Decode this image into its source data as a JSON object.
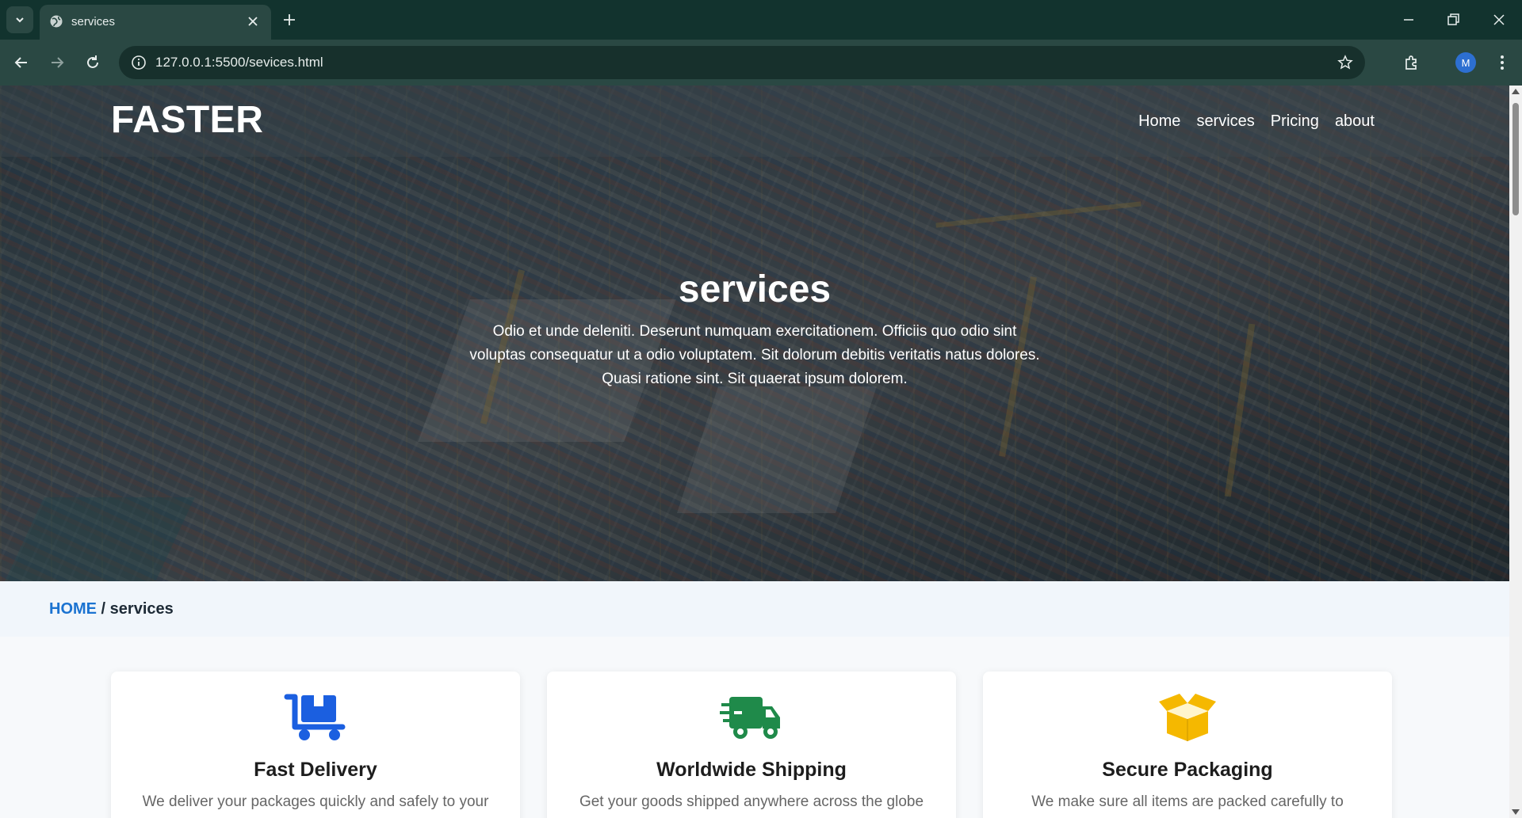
{
  "browser": {
    "tab_title": "services",
    "url": "127.0.0.1:5500/sevices.html",
    "profile_initial": "M"
  },
  "site": {
    "logo": "FASTER",
    "nav": [
      {
        "label": "Home"
      },
      {
        "label": "services"
      },
      {
        "label": "Pricing"
      },
      {
        "label": "about"
      }
    ]
  },
  "hero": {
    "title": "services",
    "text": "Odio et unde deleniti. Deserunt numquam exercitationem. Officiis quo odio sint voluptas consequatur ut a odio voluptatem. Sit dolorum debitis veritatis natus dolores. Quasi ratione sint. Sit quaerat ipsum dolorem."
  },
  "breadcrumb": {
    "home": "HOME",
    "separator": " / ",
    "current": "services"
  },
  "services": [
    {
      "title": "Fast Delivery",
      "text": "We deliver your packages quickly and safely to your",
      "icon": "dolly-icon",
      "color": "#1b5fe0"
    },
    {
      "title": "Worldwide Shipping",
      "text": "Get your goods shipped anywhere across the globe",
      "icon": "truck-fast-icon",
      "color": "#1f8a4a"
    },
    {
      "title": "Secure Packaging",
      "text": "We make sure all items are packed carefully to",
      "icon": "box-open-icon",
      "color": "#f5b800"
    }
  ]
}
